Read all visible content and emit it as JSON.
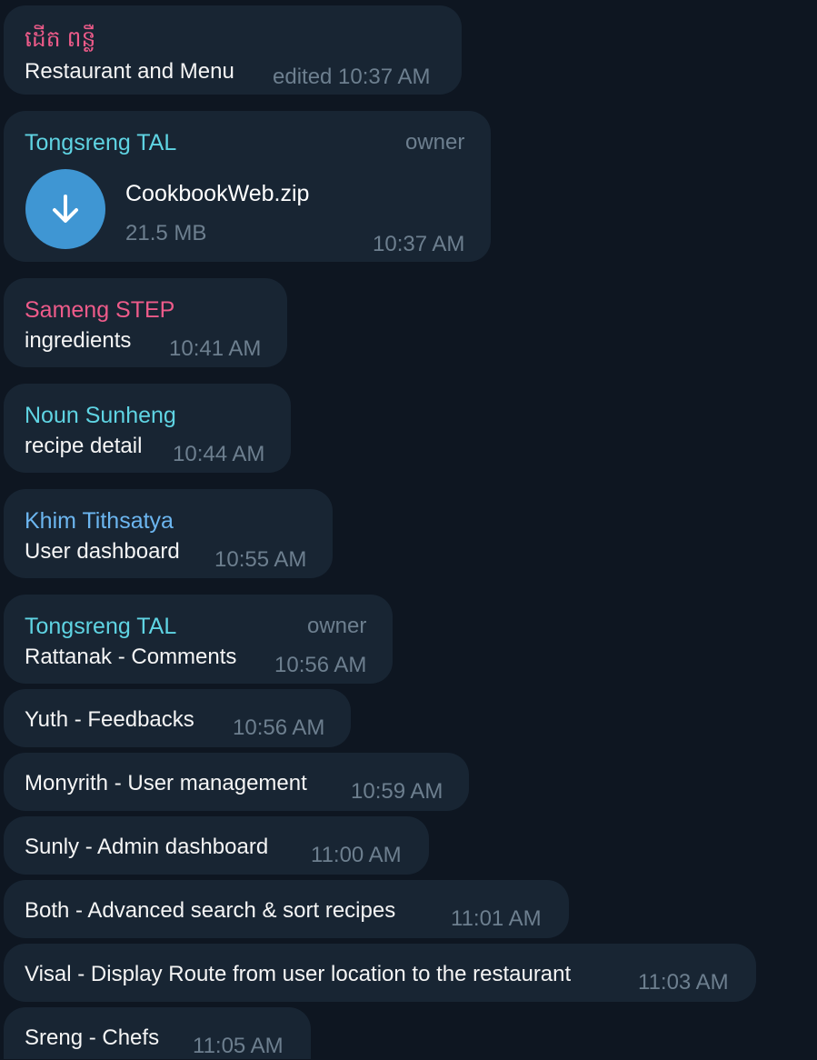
{
  "colors": {
    "background": "#0e1621",
    "bubble": "#182533",
    "name_pink": "#ee5b8a",
    "name_cyan": "#5fd4e3",
    "name_blue": "#6cb6f0",
    "file_icon": "#3f96d3",
    "meta": "#6d7f8f",
    "text": "#f5f5f5"
  },
  "messages": [
    {
      "sender": "ដើត ពន្លឺ",
      "text": "Restaurant and Menu",
      "time": "edited 10:37 AM"
    },
    {
      "sender": "Tongsreng TAL",
      "role": "owner",
      "file": {
        "name": "CookbookWeb.zip",
        "size": "21.5 MB",
        "icon": "download-arrow-icon"
      },
      "time": "10:37 AM"
    },
    {
      "sender": "Sameng STEP",
      "text": "ingredients",
      "time": "10:41 AM"
    },
    {
      "sender": "Noun Sunheng",
      "text": "recipe detail",
      "time": "10:44 AM"
    },
    {
      "sender": "Khim Tithsatya",
      "text": "User dashboard",
      "time": "10:55 AM"
    },
    {
      "sender": "Tongsreng TAL",
      "role": "owner",
      "text": "Rattanak - Comments",
      "time": "10:56 AM"
    },
    {
      "text": "Yuth - Feedbacks",
      "time": "10:56 AM"
    },
    {
      "text": "Monyrith - User management",
      "time": "10:59 AM"
    },
    {
      "text": "Sunly - Admin dashboard",
      "time": "11:00 AM"
    },
    {
      "text": "Both - Advanced search & sort recipes",
      "time": "11:01 AM"
    },
    {
      "text": "Visal - Display Route from user location to the restaurant",
      "time": "11:03 AM"
    },
    {
      "text": "Sreng - Chefs",
      "time": "11:05 AM"
    }
  ]
}
